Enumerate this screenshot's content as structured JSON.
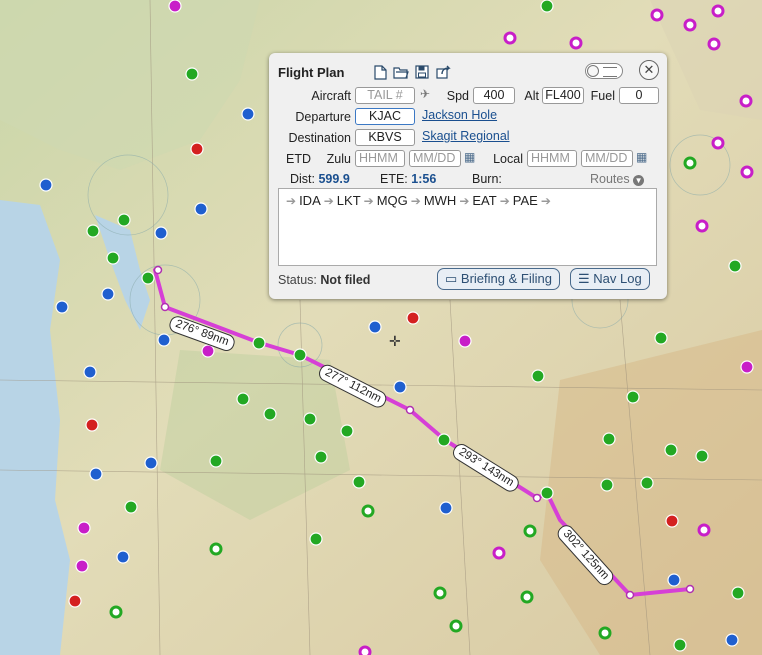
{
  "panel": {
    "title": "Flight Plan",
    "aircraft": {
      "label": "Aircraft",
      "placeholder": "TAIL #"
    },
    "speed": {
      "label": "Spd",
      "value": "400"
    },
    "altitude": {
      "label": "Alt",
      "value": "FL400"
    },
    "fuel": {
      "label": "Fuel",
      "value": "0"
    },
    "departure": {
      "label": "Departure",
      "value": "KJAC",
      "name": "Jackson Hole"
    },
    "destination": {
      "label": "Destination",
      "value": "KBVS",
      "name": "Skagit Regional"
    },
    "etd": {
      "label": "ETD",
      "zulu_label": "Zulu",
      "local_label": "Local",
      "time_placeholder": "HHMM",
      "date_placeholder": "MM/DD"
    },
    "dist": {
      "label": "Dist:",
      "value": "599.9"
    },
    "ete": {
      "label": "ETE:",
      "value": "1:56"
    },
    "burn": {
      "label": "Burn:"
    },
    "routes_label": "Routes",
    "route_waypoints": [
      "IDA",
      "LKT",
      "MQG",
      "MWH",
      "EAT",
      "PAE"
    ],
    "status": {
      "label": "Status:",
      "value": "Not filed"
    },
    "briefing_button": "Briefing & Filing",
    "navlog_button": "Nav Log"
  },
  "map": {
    "legs": [
      {
        "label": "276° 89nm"
      },
      {
        "label": "277° 112nm"
      },
      {
        "label": "293° 143nm"
      },
      {
        "label": "302° 125nm"
      }
    ],
    "route_color": "#d63fd6",
    "airport_colors": {
      "green": "#23a823",
      "blue": "#1f5fcf",
      "red": "#d42020",
      "magenta": "#c81ec8"
    }
  }
}
